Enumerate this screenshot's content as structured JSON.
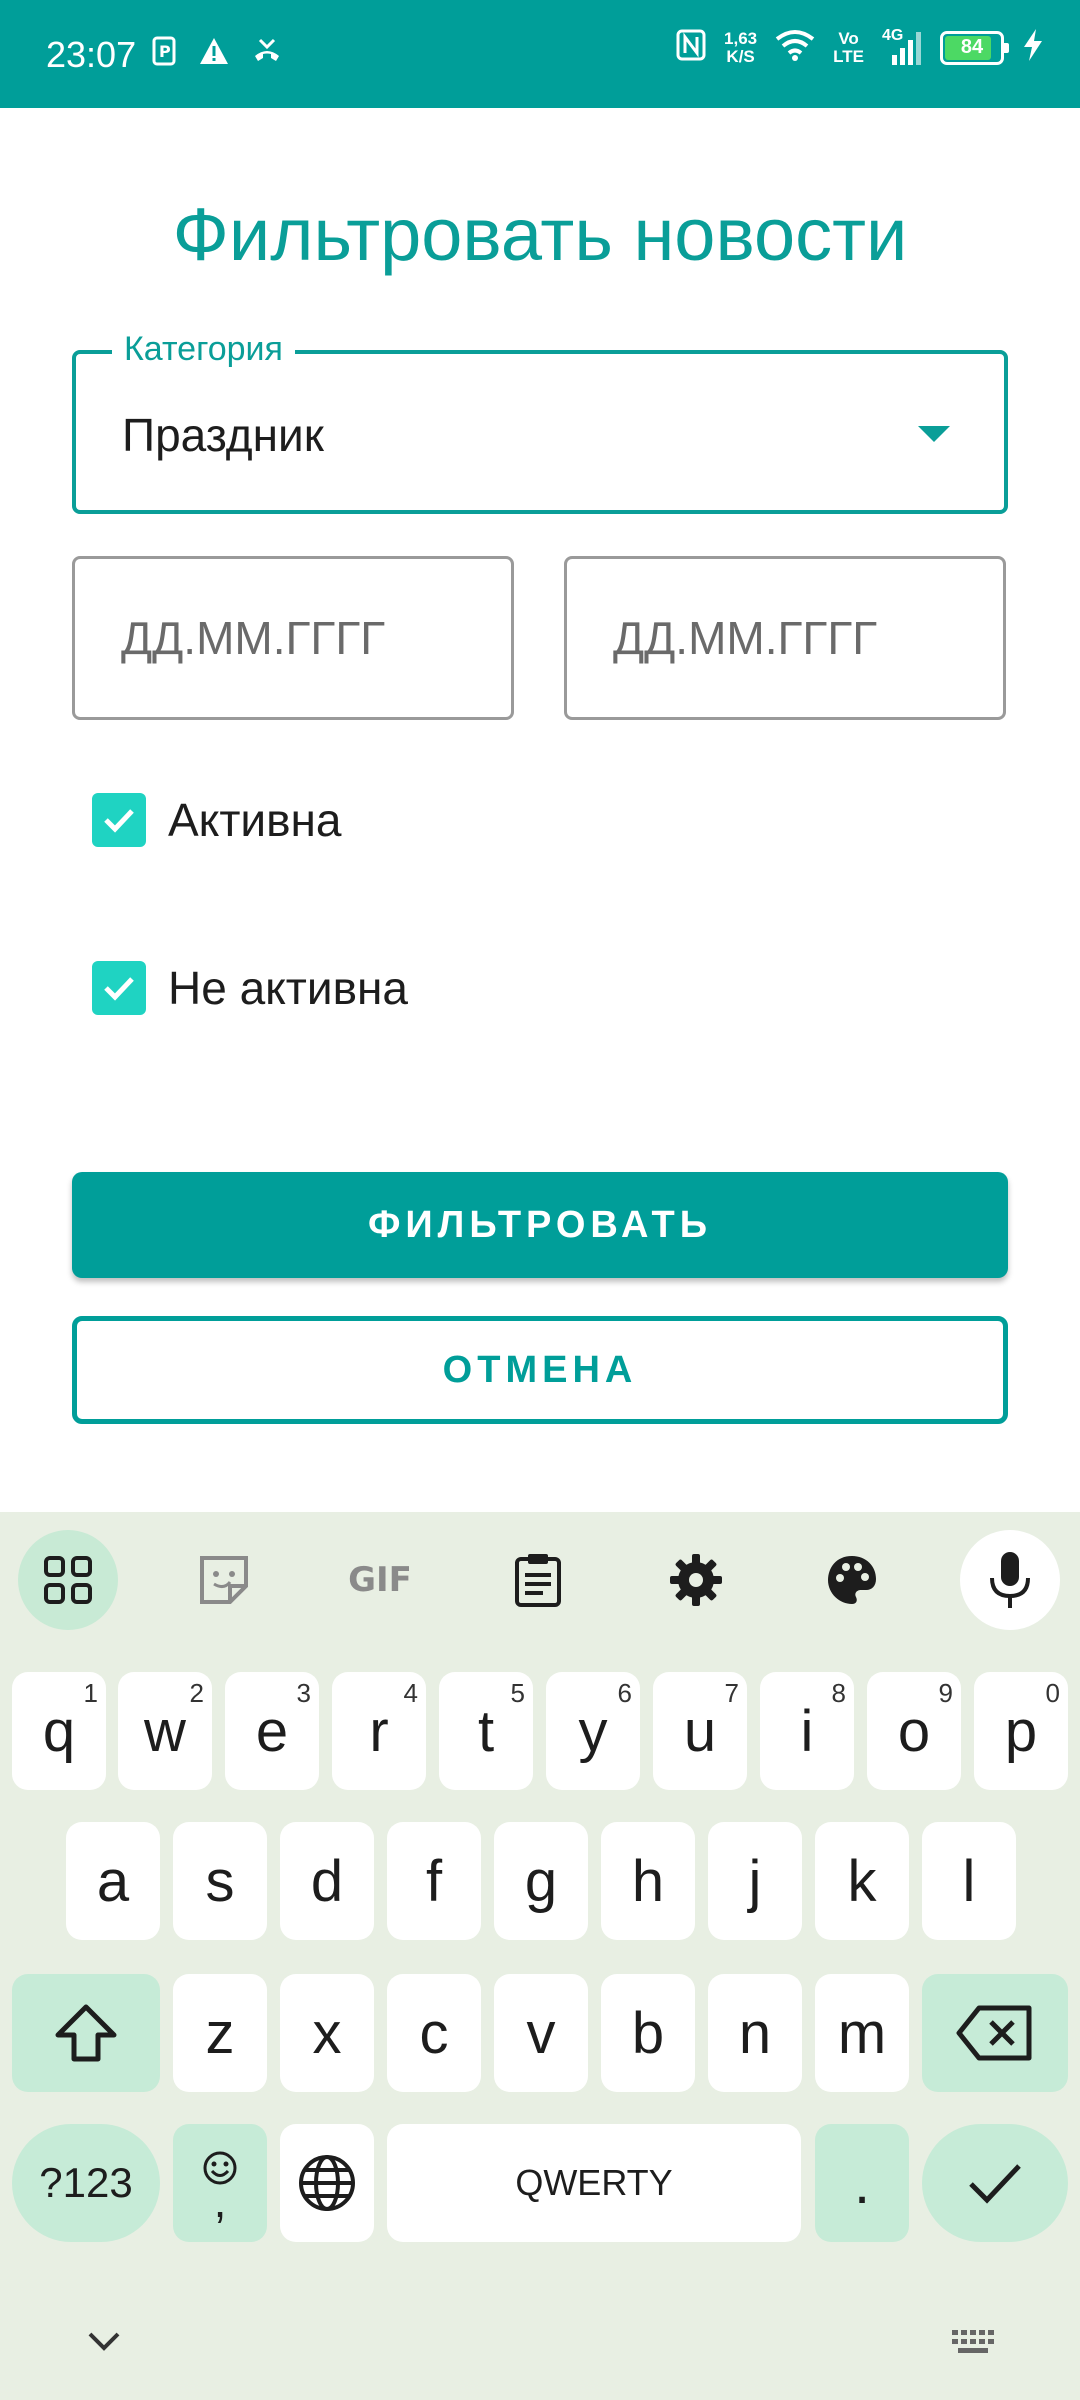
{
  "status_bar": {
    "time": "23:07",
    "network_speed": [
      "1,63",
      "K/S"
    ],
    "volte": [
      "Vo",
      "LTE"
    ],
    "network_type": "4G",
    "battery": "84"
  },
  "dialog": {
    "title": "Фильтровать новости",
    "category": {
      "label": "Категория",
      "value": "Праздник"
    },
    "date_from_placeholder": "ДД.ММ.ГГГГ",
    "date_to_placeholder": "ДД.ММ.ГГГГ",
    "checkbox_active": {
      "label": "Активна",
      "checked": true
    },
    "checkbox_inactive": {
      "label": "Не активна",
      "checked": true
    },
    "filter_button": "ФИЛЬТРОВАТЬ",
    "cancel_button": "ОТМЕНА"
  },
  "colors": {
    "primary": "#009e99",
    "checkbox": "#1fd3c2",
    "keyboard_bg": "#e8efe3",
    "keyboard_mod": "#c6ebd7"
  },
  "keyboard": {
    "toolbar": [
      "apps-grid-icon",
      "sticker-icon",
      "GIF",
      "clipboard-icon",
      "settings-icon",
      "palette-icon",
      "mic-icon"
    ],
    "row1": [
      {
        "key": "q",
        "hint": "1"
      },
      {
        "key": "w",
        "hint": "2"
      },
      {
        "key": "e",
        "hint": "3"
      },
      {
        "key": "r",
        "hint": "4"
      },
      {
        "key": "t",
        "hint": "5"
      },
      {
        "key": "y",
        "hint": "6"
      },
      {
        "key": "u",
        "hint": "7"
      },
      {
        "key": "i",
        "hint": "8"
      },
      {
        "key": "o",
        "hint": "9"
      },
      {
        "key": "p",
        "hint": "0"
      }
    ],
    "row2": [
      "a",
      "s",
      "d",
      "f",
      "g",
      "h",
      "j",
      "k",
      "l"
    ],
    "row3": [
      "z",
      "x",
      "c",
      "v",
      "b",
      "n",
      "m"
    ],
    "symbols_key": "?123",
    "comma_key": ",",
    "space_key": "QWERTY",
    "period_key": "."
  }
}
